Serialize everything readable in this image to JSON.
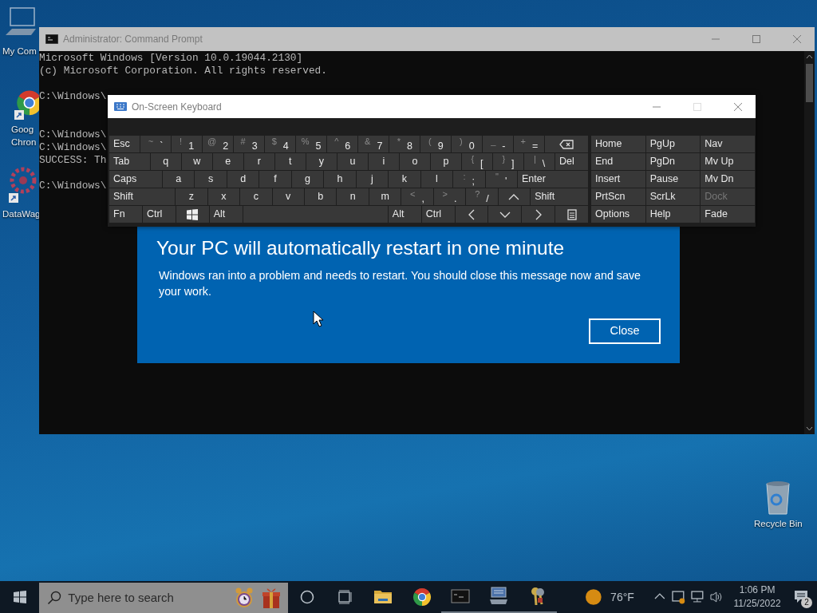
{
  "desktop_icons": [
    {
      "lines": [
        "My Com"
      ]
    },
    {
      "lines": [
        "Goog",
        "Chron"
      ]
    },
    {
      "lines": [
        "DataWag"
      ]
    },
    {
      "lines": [
        "Recycle Bin"
      ]
    }
  ],
  "cmd_window": {
    "title": "Administrator: Command Prompt",
    "lines": [
      {
        "kind": "text",
        "text": "Microsoft Windows [Version 10.0.19044.2130]"
      },
      {
        "kind": "text",
        "text": "(c) Microsoft Corporation. All rights reserved."
      },
      {
        "kind": "blank"
      },
      {
        "kind": "text",
        "text": "C:\\Windows\\"
      },
      {
        "kind": "blank"
      },
      {
        "kind": "blank"
      },
      {
        "kind": "text",
        "text": "C:\\Windows\\"
      },
      {
        "kind": "text",
        "text": "C:\\Windows\\"
      },
      {
        "kind": "text",
        "text": "SUCCESS: Th"
      },
      {
        "kind": "blank"
      },
      {
        "kind": "text",
        "text": "C:\\Windows\\"
      }
    ]
  },
  "keyboard": {
    "title": "On-Screen Keyboard",
    "rows": [
      {
        "keys": [
          {
            "kind": "label",
            "main": "Esc"
          },
          {
            "kind": "char",
            "shift": "~",
            "main": "`"
          },
          {
            "kind": "char",
            "shift": "!",
            "main": "1"
          },
          {
            "kind": "char",
            "shift": "@",
            "main": "2"
          },
          {
            "kind": "char",
            "shift": "#",
            "main": "3"
          },
          {
            "kind": "char",
            "shift": "$",
            "main": "4"
          },
          {
            "kind": "char",
            "shift": "%",
            "main": "5"
          },
          {
            "kind": "char",
            "shift": "^",
            "main": "6"
          },
          {
            "kind": "char",
            "shift": "&",
            "main": "7"
          },
          {
            "kind": "char",
            "shift": "*",
            "main": "8"
          },
          {
            "kind": "char",
            "shift": "(",
            "main": "9"
          },
          {
            "kind": "char",
            "shift": ")",
            "main": "0"
          },
          {
            "kind": "char",
            "shift": "_",
            "main": "-"
          },
          {
            "kind": "char",
            "shift": "+",
            "main": "="
          },
          {
            "kind": "icon"
          }
        ]
      },
      {
        "keys": [
          {
            "kind": "label",
            "main": "Tab"
          },
          {
            "kind": "char",
            "main": "q"
          },
          {
            "kind": "char",
            "main": "w"
          },
          {
            "kind": "char",
            "main": "e"
          },
          {
            "kind": "char",
            "main": "r"
          },
          {
            "kind": "char",
            "main": "t"
          },
          {
            "kind": "char",
            "main": "y"
          },
          {
            "kind": "char",
            "main": "u"
          },
          {
            "kind": "char",
            "main": "i"
          },
          {
            "kind": "char",
            "main": "o"
          },
          {
            "kind": "char",
            "main": "p"
          },
          {
            "kind": "char",
            "shift": "{",
            "main": "["
          },
          {
            "kind": "char",
            "shift": "}",
            "main": "]"
          },
          {
            "kind": "char",
            "shift": "|",
            "main": "\\"
          },
          {
            "kind": "label",
            "main": "Del"
          }
        ]
      },
      {
        "keys": [
          {
            "kind": "label",
            "main": "Caps"
          },
          {
            "kind": "char",
            "main": "a"
          },
          {
            "kind": "char",
            "main": "s"
          },
          {
            "kind": "char",
            "main": "d"
          },
          {
            "kind": "char",
            "main": "f"
          },
          {
            "kind": "char",
            "main": "g"
          },
          {
            "kind": "char",
            "main": "h"
          },
          {
            "kind": "char",
            "main": "j"
          },
          {
            "kind": "char",
            "main": "k"
          },
          {
            "kind": "char",
            "main": "l"
          },
          {
            "kind": "char",
            "shift": ":",
            "main": ";"
          },
          {
            "kind": "char",
            "shift": "\"",
            "main": "'"
          },
          {
            "kind": "label",
            "main": "Enter"
          }
        ]
      },
      {
        "keys": [
          {
            "kind": "label",
            "main": "Shift"
          },
          {
            "kind": "char",
            "main": "z"
          },
          {
            "kind": "char",
            "main": "x"
          },
          {
            "kind": "char",
            "main": "c"
          },
          {
            "kind": "char",
            "main": "v"
          },
          {
            "kind": "char",
            "main": "b"
          },
          {
            "kind": "char",
            "main": "n"
          },
          {
            "kind": "char",
            "main": "m"
          },
          {
            "kind": "char",
            "shift": "<",
            "main": ","
          },
          {
            "kind": "char",
            "shift": ">",
            "main": "."
          },
          {
            "kind": "char",
            "shift": "?",
            "main": "/"
          },
          {
            "kind": "icon"
          },
          {
            "kind": "label",
            "main": "Shift"
          }
        ]
      },
      {
        "keys": [
          {
            "kind": "label",
            "main": "Fn"
          },
          {
            "kind": "label",
            "main": "Ctrl"
          },
          {
            "kind": "icon"
          },
          {
            "kind": "label",
            "main": "Alt"
          },
          {
            "kind": "space"
          },
          {
            "kind": "label",
            "main": "Alt"
          },
          {
            "kind": "label",
            "main": "Ctrl"
          },
          {
            "kind": "icon"
          },
          {
            "kind": "icon"
          },
          {
            "kind": "icon"
          },
          {
            "kind": "icon"
          }
        ]
      }
    ],
    "nav_rows": [
      [
        {
          "label": "Home",
          "disabled": false
        },
        {
          "label": "PgUp",
          "disabled": false
        },
        {
          "label": "Nav",
          "disabled": false
        }
      ],
      [
        {
          "label": "End",
          "disabled": false
        },
        {
          "label": "PgDn",
          "disabled": false
        },
        {
          "label": "Mv Up",
          "disabled": false
        }
      ],
      [
        {
          "label": "Insert",
          "disabled": false
        },
        {
          "label": "Pause",
          "disabled": false
        },
        {
          "label": "Mv Dn",
          "disabled": false
        }
      ],
      [
        {
          "label": "PrtScn",
          "disabled": false
        },
        {
          "label": "ScrLk",
          "disabled": false
        },
        {
          "label": "Dock",
          "disabled": true
        }
      ],
      [
        {
          "label": "Options",
          "disabled": false
        },
        {
          "label": "Help",
          "disabled": false
        },
        {
          "label": "Fade",
          "disabled": false
        }
      ]
    ]
  },
  "dialog": {
    "title": "Your PC will automatically restart in one minute",
    "message": "Windows ran into a problem and needs to restart. You should close this message now and save your work.",
    "button": "Close"
  },
  "taskbar": {
    "search": {
      "placeholder": "Type here to search"
    },
    "apps": [
      {
        "running": false
      },
      {
        "running": false
      },
      {
        "running": true
      },
      {
        "running": true
      },
      {
        "running": true
      }
    ],
    "weather": "76°F",
    "time": "1:06 PM",
    "date": "11/25/2022",
    "notification_count": "2"
  }
}
